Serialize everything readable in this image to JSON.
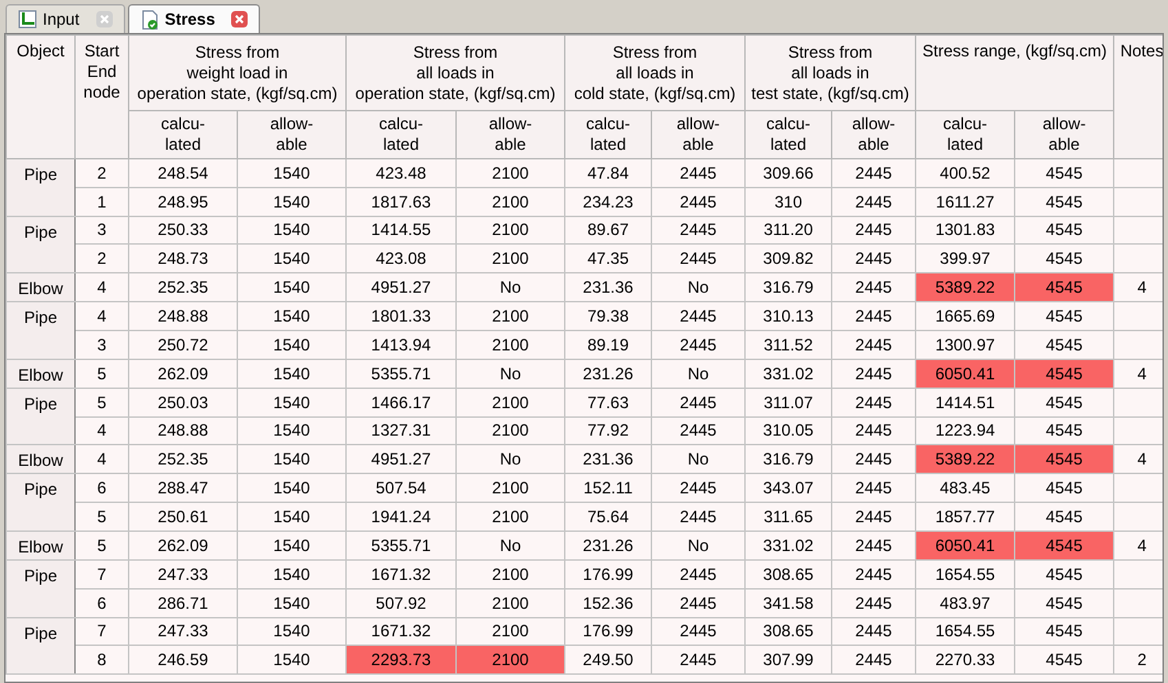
{
  "tabs": [
    {
      "label": "Input",
      "kind": "input",
      "selected": false
    },
    {
      "label": "Stress",
      "kind": "stress",
      "selected": true
    }
  ],
  "table": {
    "columns": {
      "object": "Object",
      "node": [
        "Start",
        "End",
        "node"
      ],
      "groups": [
        {
          "title": [
            "Stress from",
            "weight load in",
            "operation state, (kgf/sq.cm)"
          ],
          "sub": [
            [
              "calcu-",
              "lated"
            ],
            [
              "allow-",
              "able"
            ]
          ]
        },
        {
          "title": [
            "Stress from",
            "all loads in",
            "operation state, (kgf/sq.cm)"
          ],
          "sub": [
            [
              "calcu-",
              "lated"
            ],
            [
              "allow-",
              "able"
            ]
          ]
        },
        {
          "title": [
            "Stress from",
            "all loads in",
            "cold state, (kgf/sq.cm)"
          ],
          "sub": [
            [
              "calcu-",
              "lated"
            ],
            [
              "allow-",
              "able"
            ]
          ]
        },
        {
          "title": [
            "Stress from",
            "all loads in",
            "test state, (kgf/sq.cm)"
          ],
          "sub": [
            [
              "calcu-",
              "lated"
            ],
            [
              "allow-",
              "able"
            ]
          ]
        },
        {
          "title": [
            "Stress range, (kgf/sq.cm)"
          ],
          "sub": [
            [
              "calcu-",
              "lated"
            ],
            [
              "allow-",
              "able"
            ]
          ]
        }
      ],
      "notes": "Notes"
    },
    "groups": [
      {
        "object": "Pipe",
        "rows": [
          {
            "node": "2",
            "stress": [
              [
                "248.54",
                "1540"
              ],
              [
                "423.48",
                "2100"
              ],
              [
                "47.84",
                "2445"
              ],
              [
                "309.66",
                "2445"
              ],
              [
                "400.52",
                "4545"
              ]
            ],
            "exceeded": [
              false,
              false,
              false,
              false,
              false
            ]
          },
          {
            "node": "1",
            "stress": [
              [
                "248.95",
                "1540"
              ],
              [
                "1817.63",
                "2100"
              ],
              [
                "234.23",
                "2445"
              ],
              [
                "310",
                "2445"
              ],
              [
                "1611.27",
                "4545"
              ]
            ],
            "exceeded": [
              false,
              false,
              false,
              false,
              false
            ]
          }
        ]
      },
      {
        "object": "Pipe",
        "rows": [
          {
            "node": "3",
            "stress": [
              [
                "250.33",
                "1540"
              ],
              [
                "1414.55",
                "2100"
              ],
              [
                "89.67",
                "2445"
              ],
              [
                "311.20",
                "2445"
              ],
              [
                "1301.83",
                "4545"
              ]
            ],
            "exceeded": [
              false,
              false,
              false,
              false,
              false
            ]
          },
          {
            "node": "2",
            "stress": [
              [
                "248.73",
                "1540"
              ],
              [
                "423.08",
                "2100"
              ],
              [
                "47.35",
                "2445"
              ],
              [
                "309.82",
                "2445"
              ],
              [
                "399.97",
                "4545"
              ]
            ],
            "exceeded": [
              false,
              false,
              false,
              false,
              false
            ]
          }
        ]
      },
      {
        "object": "Elbow",
        "rows": [
          {
            "node": "4",
            "stress": [
              [
                "252.35",
                "1540"
              ],
              [
                "4951.27",
                "No"
              ],
              [
                "231.36",
                "No"
              ],
              [
                "316.79",
                "2445"
              ],
              [
                "5389.22",
                "4545"
              ]
            ],
            "exceeded": [
              false,
              false,
              false,
              false,
              true
            ],
            "notes": "4"
          }
        ]
      },
      {
        "object": "Pipe",
        "rows": [
          {
            "node": "4",
            "stress": [
              [
                "248.88",
                "1540"
              ],
              [
                "1801.33",
                "2100"
              ],
              [
                "79.38",
                "2445"
              ],
              [
                "310.13",
                "2445"
              ],
              [
                "1665.69",
                "4545"
              ]
            ],
            "exceeded": [
              false,
              false,
              false,
              false,
              false
            ]
          },
          {
            "node": "3",
            "stress": [
              [
                "250.72",
                "1540"
              ],
              [
                "1413.94",
                "2100"
              ],
              [
                "89.19",
                "2445"
              ],
              [
                "311.52",
                "2445"
              ],
              [
                "1300.97",
                "4545"
              ]
            ],
            "exceeded": [
              false,
              false,
              false,
              false,
              false
            ]
          }
        ]
      },
      {
        "object": "Elbow",
        "rows": [
          {
            "node": "5",
            "stress": [
              [
                "262.09",
                "1540"
              ],
              [
                "5355.71",
                "No"
              ],
              [
                "231.26",
                "No"
              ],
              [
                "331.02",
                "2445"
              ],
              [
                "6050.41",
                "4545"
              ]
            ],
            "exceeded": [
              false,
              false,
              false,
              false,
              true
            ],
            "notes": "4"
          }
        ]
      },
      {
        "object": "Pipe",
        "rows": [
          {
            "node": "5",
            "stress": [
              [
                "250.03",
                "1540"
              ],
              [
                "1466.17",
                "2100"
              ],
              [
                "77.63",
                "2445"
              ],
              [
                "311.07",
                "2445"
              ],
              [
                "1414.51",
                "4545"
              ]
            ],
            "exceeded": [
              false,
              false,
              false,
              false,
              false
            ]
          },
          {
            "node": "4",
            "stress": [
              [
                "248.88",
                "1540"
              ],
              [
                "1327.31",
                "2100"
              ],
              [
                "77.92",
                "2445"
              ],
              [
                "310.05",
                "2445"
              ],
              [
                "1223.94",
                "4545"
              ]
            ],
            "exceeded": [
              false,
              false,
              false,
              false,
              false
            ]
          }
        ]
      },
      {
        "object": "Elbow",
        "rows": [
          {
            "node": "4",
            "stress": [
              [
                "252.35",
                "1540"
              ],
              [
                "4951.27",
                "No"
              ],
              [
                "231.36",
                "No"
              ],
              [
                "316.79",
                "2445"
              ],
              [
                "5389.22",
                "4545"
              ]
            ],
            "exceeded": [
              false,
              false,
              false,
              false,
              true
            ],
            "notes": "4"
          }
        ]
      },
      {
        "object": "Pipe",
        "rows": [
          {
            "node": "6",
            "stress": [
              [
                "288.47",
                "1540"
              ],
              [
                "507.54",
                "2100"
              ],
              [
                "152.11",
                "2445"
              ],
              [
                "343.07",
                "2445"
              ],
              [
                "483.45",
                "4545"
              ]
            ],
            "exceeded": [
              false,
              false,
              false,
              false,
              false
            ]
          },
          {
            "node": "5",
            "stress": [
              [
                "250.61",
                "1540"
              ],
              [
                "1941.24",
                "2100"
              ],
              [
                "75.64",
                "2445"
              ],
              [
                "311.65",
                "2445"
              ],
              [
                "1857.77",
                "4545"
              ]
            ],
            "exceeded": [
              false,
              false,
              false,
              false,
              false
            ]
          }
        ]
      },
      {
        "object": "Elbow",
        "rows": [
          {
            "node": "5",
            "stress": [
              [
                "262.09",
                "1540"
              ],
              [
                "5355.71",
                "No"
              ],
              [
                "231.26",
                "No"
              ],
              [
                "331.02",
                "2445"
              ],
              [
                "6050.41",
                "4545"
              ]
            ],
            "exceeded": [
              false,
              false,
              false,
              false,
              true
            ],
            "notes": "4"
          }
        ]
      },
      {
        "object": "Pipe",
        "rows": [
          {
            "node": "7",
            "stress": [
              [
                "247.33",
                "1540"
              ],
              [
                "1671.32",
                "2100"
              ],
              [
                "176.99",
                "2445"
              ],
              [
                "308.65",
                "2445"
              ],
              [
                "1654.55",
                "4545"
              ]
            ],
            "exceeded": [
              false,
              false,
              false,
              false,
              false
            ]
          },
          {
            "node": "6",
            "stress": [
              [
                "286.71",
                "1540"
              ],
              [
                "507.92",
                "2100"
              ],
              [
                "152.36",
                "2445"
              ],
              [
                "341.58",
                "2445"
              ],
              [
                "483.97",
                "4545"
              ]
            ],
            "exceeded": [
              false,
              false,
              false,
              false,
              false
            ]
          }
        ]
      },
      {
        "object": "Pipe",
        "rows": [
          {
            "node": "7",
            "stress": [
              [
                "247.33",
                "1540"
              ],
              [
                "1671.32",
                "2100"
              ],
              [
                "176.99",
                "2445"
              ],
              [
                "308.65",
                "2445"
              ],
              [
                "1654.55",
                "4545"
              ]
            ],
            "exceeded": [
              false,
              false,
              false,
              false,
              false
            ]
          },
          {
            "node": "8",
            "stress": [
              [
                "246.59",
                "1540"
              ],
              [
                "2293.73",
                "2100"
              ],
              [
                "249.50",
                "2445"
              ],
              [
                "307.99",
                "2445"
              ],
              [
                "2270.33",
                "4545"
              ]
            ],
            "exceeded": [
              false,
              true,
              false,
              false,
              false
            ],
            "notes": "2"
          }
        ]
      }
    ]
  }
}
